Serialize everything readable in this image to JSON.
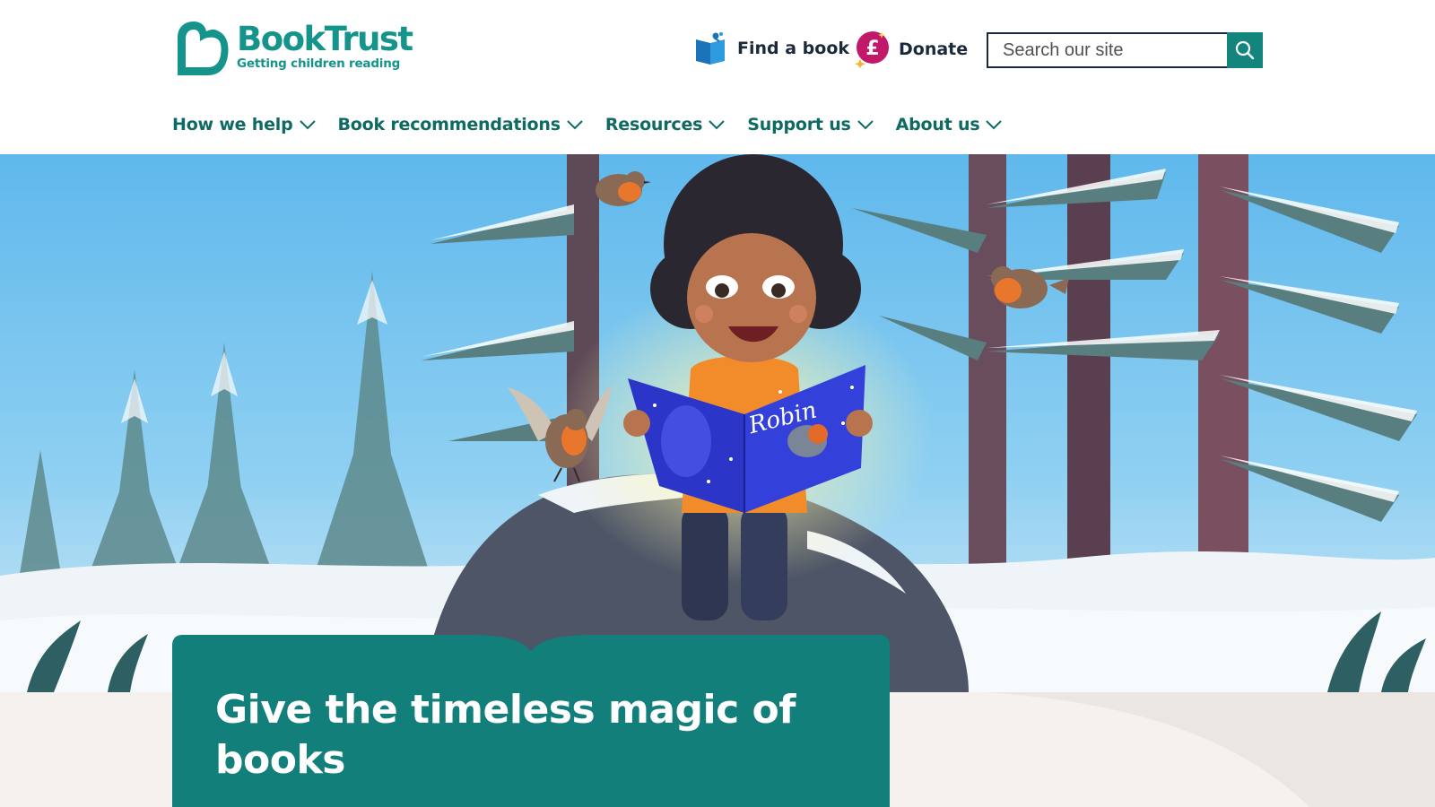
{
  "logo": {
    "name": "BookTrust",
    "tagline": "Getting children reading"
  },
  "utility": {
    "find_book": "Find a book",
    "donate": "Donate"
  },
  "search": {
    "placeholder": "Search our site"
  },
  "nav": [
    {
      "label": "How we help"
    },
    {
      "label": "Book recommendations"
    },
    {
      "label": "Resources"
    },
    {
      "label": "Support us"
    },
    {
      "label": "About us"
    }
  ],
  "hero": {
    "book_cover_text": "Robin",
    "title": "Give the timeless magic of books"
  },
  "colors": {
    "brand_teal": "#14948b",
    "card_teal": "#127f7a",
    "donate_pink": "#c2186a",
    "sky_blue": "#6cc2ee"
  }
}
